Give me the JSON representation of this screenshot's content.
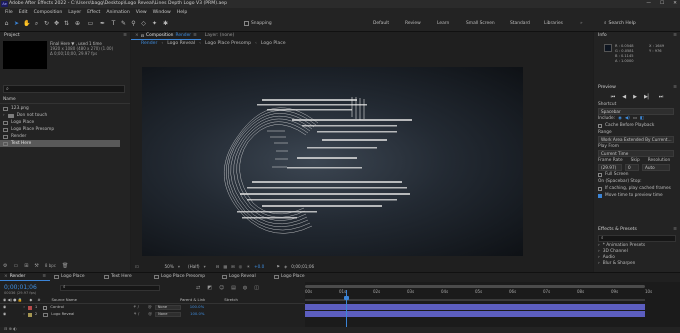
{
  "title_bar": {
    "logo": "Ae",
    "text": "Adobe After Effects 2022 - C:\\Users\\bagg\\Desktop\\Logo Reveal\\Lines Depth Logo V3 (PRM).aep",
    "minimize": "—",
    "maximize": "☐",
    "close": "✕"
  },
  "menu": [
    "File",
    "Edit",
    "Composition",
    "Layer",
    "Effect",
    "Animation",
    "View",
    "Window",
    "Help"
  ],
  "toolbar": {
    "snapping": "Snapping",
    "workspaces": [
      "Default",
      "Review",
      "Learn",
      "Small Screen",
      "Standard",
      "Libraries"
    ],
    "search": "Search Help"
  },
  "project": {
    "title": "Project",
    "preview_name": "Final Here ▼ , used 1 time",
    "preview_meta_1": "1920 x 1080 (480 x 270) (1.00)",
    "preview_meta_2": "Δ 0;00;10;00, 29.97 fps",
    "search_placeholder": "",
    "col_name": "Name",
    "items": [
      {
        "icon": "image",
        "name": "123.png"
      },
      {
        "icon": "folder",
        "name": "Don not touch"
      },
      {
        "icon": "comp",
        "name": "Logo Place"
      },
      {
        "icon": "comp",
        "name": "Logo Place Presomp"
      },
      {
        "icon": "comp",
        "name": "Render"
      },
      {
        "icon": "comp",
        "name": "Text Here"
      }
    ],
    "footer_bpc": "8 bpc"
  },
  "composition": {
    "tab_title": "Composition",
    "tab_name": "Render",
    "layer_tab": "Layer: (none)",
    "breadcrumbs": [
      "Render",
      "Logo Reveal",
      "Logo Place Presomp",
      "Logo Place"
    ],
    "zoom": "50%",
    "resolution": "(Half)",
    "exposure": "+0.0",
    "timecode": "0;00;01;06"
  },
  "right": {
    "info": {
      "title": "Info",
      "r": "R : 0.0548",
      "g": "G : 0.0581",
      "b": "B : 0.1145",
      "a": "A : 1.0000",
      "x": "X : 1649",
      "y": "Y : 976"
    },
    "preview": {
      "title": "Preview",
      "shortcut_label": "Shortcut",
      "shortcut_value": "Spacebar",
      "include_label": "Include:",
      "cache_label": "Cache Before Playback",
      "range_label": "Range",
      "range_value": "Work Area Extended By Current...",
      "play_from_label": "Play From",
      "play_from_value": "Current Time",
      "frame_rate_label": "Frame Rate",
      "skip_label": "Skip",
      "resolution_label": "Resolution",
      "frame_rate_value": "(29.97)",
      "skip_value": "0",
      "resolution_value": "Auto",
      "fullscreen_label": "Full Screen",
      "on_stop_label": "On (Spacebar) Stop:",
      "if_caching": "If caching, play cached frames",
      "move_time": "Move time to preview time"
    },
    "effects": {
      "title": "Effects & Presets",
      "search_placeholder": "",
      "items": [
        "* Animation Presets",
        "3D Channel",
        "Audio",
        "Blur & Sharpen"
      ]
    }
  },
  "timeline": {
    "tabs": [
      "Render",
      "Logo Place",
      "Text Here",
      "Logo Place Presomp",
      "Logo Reveal",
      "Logo Place"
    ],
    "timecode": "0;00;01;06",
    "fps_text": "00036 (29.97 fps)",
    "col_name": "Source Name",
    "col_parent": "Parent & Link",
    "col_stretch": "Stretch",
    "layers": [
      {
        "num": "1",
        "name": "Control",
        "parent": "None",
        "stretch": "100.0%"
      },
      {
        "num": "2",
        "name": "Logo Reveal",
        "parent": "None",
        "stretch": "100.0%"
      }
    ],
    "ruler": [
      "00s",
      "01s",
      "02s",
      "03s",
      "04s",
      "05s",
      "06s",
      "07s",
      "08s",
      "09s",
      "10s"
    ],
    "playhead_fraction": 0.12,
    "accent_color": "#3b84d6",
    "bar_color": "#5c5ec0"
  }
}
